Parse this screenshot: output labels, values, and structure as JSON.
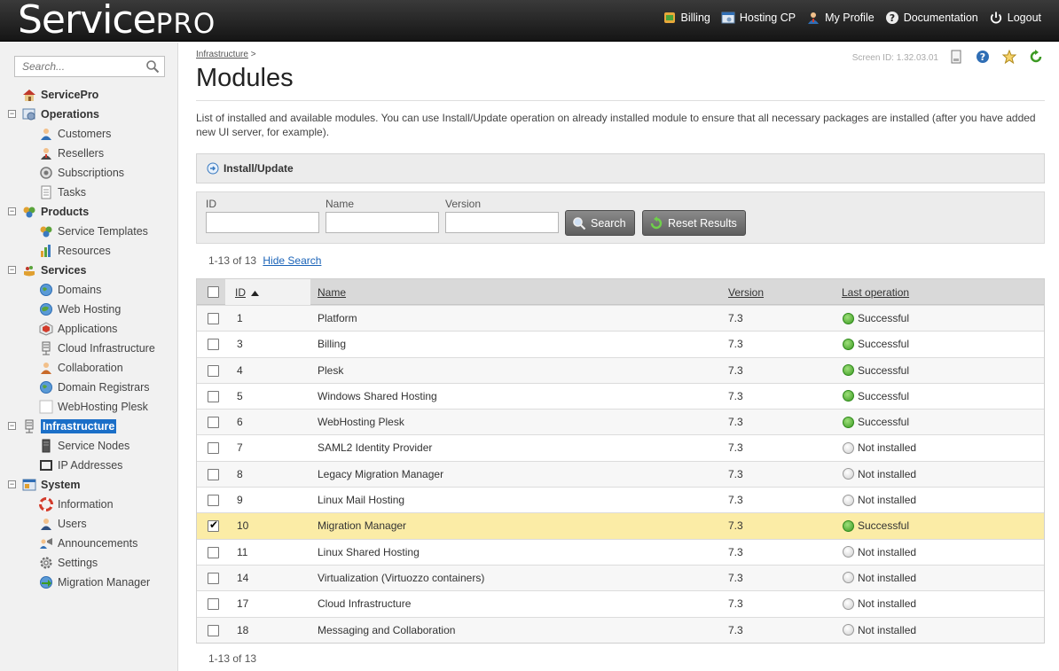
{
  "app": {
    "logo_main": "Service",
    "logo_suffix": "PRO"
  },
  "topnav": [
    {
      "label": "Billing",
      "icon": "billing-icon"
    },
    {
      "label": "Hosting CP",
      "icon": "hosting-cp-icon"
    },
    {
      "label": "My Profile",
      "icon": "user-icon"
    },
    {
      "label": "Documentation",
      "icon": "help-icon"
    },
    {
      "label": "Logout",
      "icon": "power-icon"
    }
  ],
  "sidebar": {
    "search_placeholder": "Search...",
    "items": [
      {
        "label": "ServicePro"
      },
      {
        "label": "Operations"
      },
      {
        "label": "Customers"
      },
      {
        "label": "Resellers"
      },
      {
        "label": "Subscriptions"
      },
      {
        "label": "Tasks"
      },
      {
        "label": "Products"
      },
      {
        "label": "Service Templates"
      },
      {
        "label": "Resources"
      },
      {
        "label": "Services"
      },
      {
        "label": "Domains"
      },
      {
        "label": "Web Hosting"
      },
      {
        "label": "Applications"
      },
      {
        "label": "Cloud Infrastructure"
      },
      {
        "label": "Collaboration"
      },
      {
        "label": "Domain Registrars"
      },
      {
        "label": "WebHosting Plesk"
      },
      {
        "label": "Infrastructure"
      },
      {
        "label": "Service Nodes"
      },
      {
        "label": "IP Addresses"
      },
      {
        "label": "System"
      },
      {
        "label": "Information"
      },
      {
        "label": "Users"
      },
      {
        "label": "Announcements"
      },
      {
        "label": "Settings"
      },
      {
        "label": "Migration Manager"
      }
    ]
  },
  "page": {
    "breadcrumb": "Infrastructure",
    "breadcrumb_sep": ">",
    "title": "Modules",
    "screen_id": "Screen ID:  1.32.03.01",
    "description": "List of installed and available modules. You can use Install/Update operation on already installed module to ensure that all necessary packages are installed (after you have added new UI server, for example).",
    "action_label": "Install/Update"
  },
  "filter": {
    "id_label": "ID",
    "id_value": "",
    "name_label": "Name",
    "name_value": "",
    "version_label": "Version",
    "version_value": "",
    "search_button": "Search",
    "reset_button": "Reset Results"
  },
  "results": {
    "count_top": "1-13 of 13",
    "hide_search": "Hide Search",
    "count_bottom": "1-13 of 13"
  },
  "table": {
    "headers": {
      "id": "ID",
      "name": "Name",
      "version": "Version",
      "last_operation": "Last operation"
    },
    "sort": "id-ascending",
    "rows": [
      {
        "id": "1",
        "name": "Platform",
        "version": "7.3",
        "status": "Successful",
        "ok": true,
        "checked": false
      },
      {
        "id": "3",
        "name": "Billing",
        "version": "7.3",
        "status": "Successful",
        "ok": true,
        "checked": false
      },
      {
        "id": "4",
        "name": "Plesk",
        "version": "7.3",
        "status": "Successful",
        "ok": true,
        "checked": false
      },
      {
        "id": "5",
        "name": "Windows Shared Hosting",
        "version": "7.3",
        "status": "Successful",
        "ok": true,
        "checked": false
      },
      {
        "id": "6",
        "name": "WebHosting Plesk",
        "version": "7.3",
        "status": "Successful",
        "ok": true,
        "checked": false
      },
      {
        "id": "7",
        "name": "SAML2 Identity Provider",
        "version": "7.3",
        "status": "Not installed",
        "ok": false,
        "checked": false
      },
      {
        "id": "8",
        "name": "Legacy Migration Manager",
        "version": "7.3",
        "status": "Not installed",
        "ok": false,
        "checked": false
      },
      {
        "id": "9",
        "name": "Linux Mail Hosting",
        "version": "7.3",
        "status": "Not installed",
        "ok": false,
        "checked": false
      },
      {
        "id": "10",
        "name": "Migration Manager",
        "version": "7.3",
        "status": "Successful",
        "ok": true,
        "checked": true
      },
      {
        "id": "11",
        "name": "Linux Shared Hosting",
        "version": "7.3",
        "status": "Not installed",
        "ok": false,
        "checked": false
      },
      {
        "id": "14",
        "name": "Virtualization (Virtuozzo containers)",
        "version": "7.3",
        "status": "Not installed",
        "ok": false,
        "checked": false
      },
      {
        "id": "17",
        "name": "Cloud Infrastructure",
        "version": "7.3",
        "status": "Not installed",
        "ok": false,
        "checked": false
      },
      {
        "id": "18",
        "name": "Messaging and Collaboration",
        "version": "7.3",
        "status": "Not installed",
        "ok": false,
        "checked": false
      }
    ]
  },
  "colors": {
    "selected_row": "#fbeca6",
    "link": "#1a63b8",
    "selected_nav": "#1b6fc8",
    "success": "#3c9a23"
  }
}
